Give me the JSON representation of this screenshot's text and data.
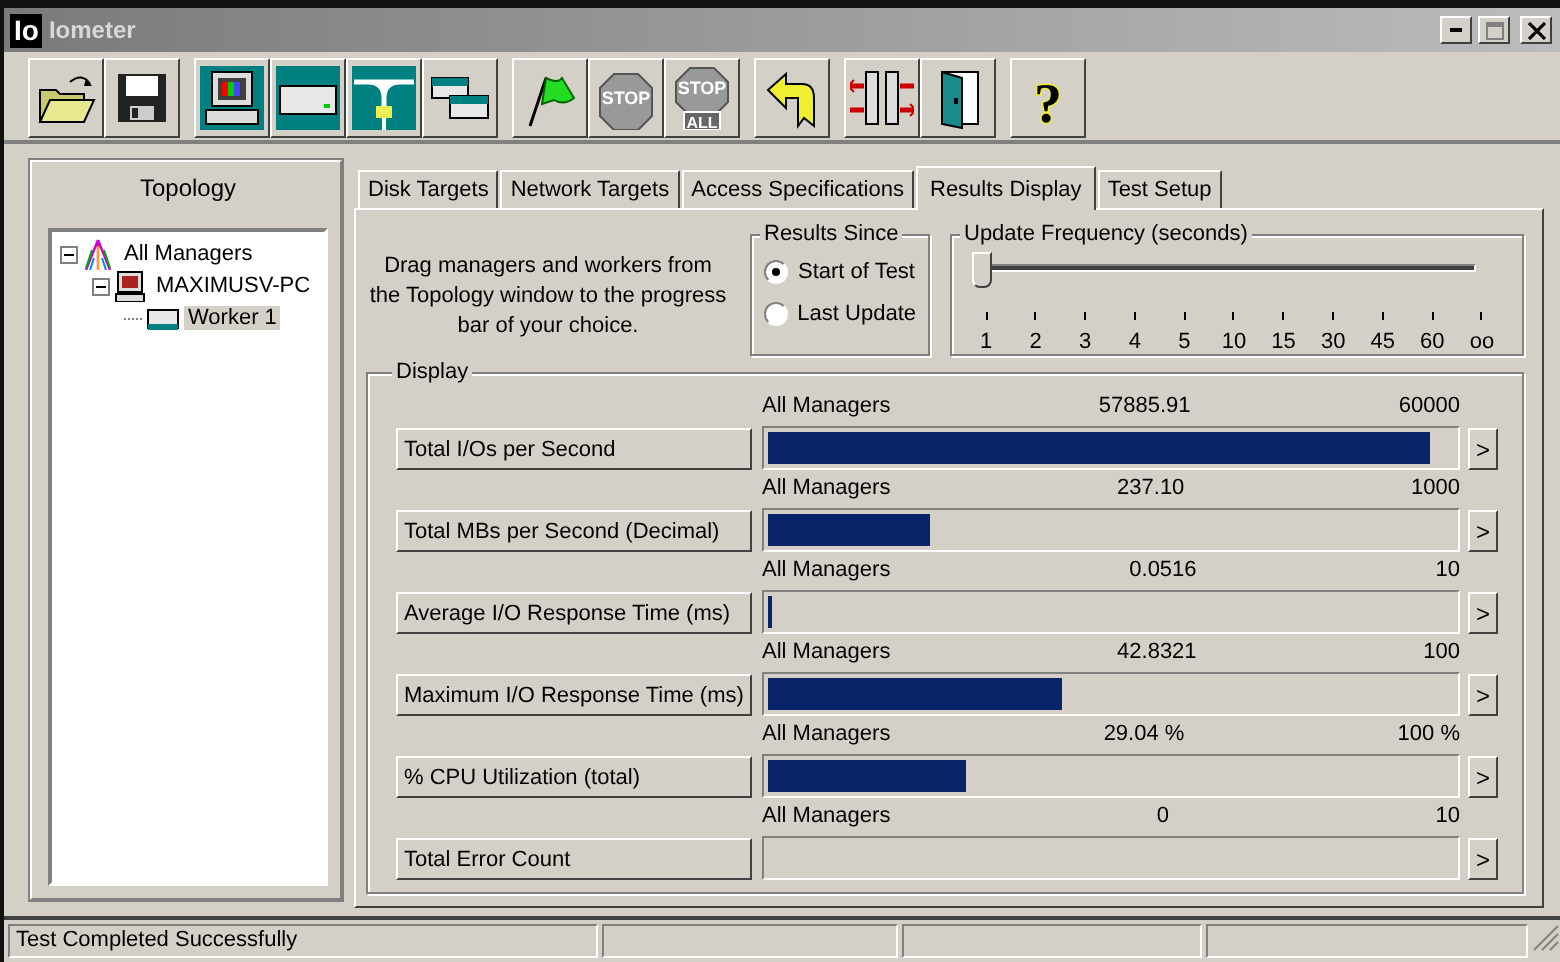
{
  "window": {
    "icon_text": "Io",
    "title": "Iometer",
    "controls": [
      {
        "kind": "minimize"
      },
      {
        "kind": "maximize"
      },
      {
        "kind": "close"
      }
    ]
  },
  "toolbar": [
    [
      {
        "kind": "open"
      },
      {
        "kind": "save"
      }
    ],
    [
      {
        "kind": "computer"
      },
      {
        "kind": "disk"
      },
      {
        "kind": "network"
      },
      {
        "kind": "workers"
      }
    ],
    [
      {
        "kind": "flag"
      },
      {
        "kind": "stop",
        "label": "STOP"
      },
      {
        "kind": "stop_all",
        "label": "STOP",
        "sublabel": "ALL"
      }
    ],
    [
      {
        "kind": "reset"
      }
    ],
    [
      {
        "kind": "exchange"
      },
      {
        "kind": "exit"
      }
    ],
    [
      {
        "kind": "help",
        "label": "?"
      }
    ]
  ],
  "topology": {
    "title": "Topology",
    "tree": [
      {
        "kind": "managers",
        "label": "All Managers",
        "expanded": true,
        "selected": false,
        "children": [
          {
            "kind": "computer",
            "label": "MAXIMUSV-PC",
            "expanded": true,
            "selected": false,
            "children": [
              {
                "kind": "worker",
                "label": "Worker 1",
                "selected": true
              }
            ]
          }
        ]
      }
    ]
  },
  "tabs": [
    {
      "label": "Disk Targets",
      "selected": false
    },
    {
      "label": "Network Targets",
      "selected": false
    },
    {
      "label": "Access Specifications",
      "selected": false
    },
    {
      "label": "Results Display",
      "selected": true
    },
    {
      "label": "Test Setup",
      "selected": false
    }
  ],
  "instructions": "Drag managers and workers from the Topology window to the progress bar of your choice.",
  "results_since": {
    "title": "Results Since",
    "options": [
      {
        "label": "Start of Test",
        "selected": true
      },
      {
        "label": "Last Update",
        "selected": false
      }
    ]
  },
  "update_frequency": {
    "title": "Update Frequency (seconds)",
    "level": 0,
    "ticks": [
      "1",
      "2",
      "3",
      "4",
      "5",
      "10",
      "15",
      "30",
      "45",
      "60",
      "oo"
    ]
  },
  "display": {
    "title": "Display",
    "rows": [
      {
        "label": "Total I/Os per Second",
        "source": "All Managers",
        "value": "57885.91",
        "max": "60000",
        "level": 0.965
      },
      {
        "label": "Total MBs per Second (Decimal)",
        "source": "All Managers",
        "value": "237.10",
        "max": "1000",
        "level": 0.237
      },
      {
        "label": "Average I/O Response Time (ms)",
        "source": "All Managers",
        "value": "0.0516",
        "max": "10",
        "level": 0.005
      },
      {
        "label": "Maximum I/O Response Time (ms)",
        "source": "All Managers",
        "value": "42.8321",
        "max": "100",
        "level": 0.428
      },
      {
        "label": "% CPU Utilization (total)",
        "source": "All Managers",
        "value": "29.04 %",
        "max": "100 %",
        "level": 0.29
      },
      {
        "label": "Total Error Count",
        "source": "All Managers",
        "value": "0",
        "max": "10",
        "level": 0
      }
    ],
    "arrow": ">"
  },
  "status_bar": {
    "message": "Test Completed Successfully"
  }
}
